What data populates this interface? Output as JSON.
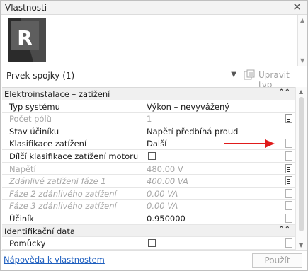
{
  "window": {
    "title": "Vlastnosti",
    "close_glyph": "✕"
  },
  "header": {
    "logo_letter": "R"
  },
  "type_selector": {
    "selected": "Prvek spojky (1)",
    "edit_type_label": "Upravit typ"
  },
  "properties": {
    "groups": [
      {
        "title": "Elektroinstalace – zatížení",
        "collapse_glyph": "⌃⌃",
        "rows": [
          {
            "label": "Typ systému",
            "value": "Výkon – nevyvážený",
            "state": "enabled",
            "control": "none"
          },
          {
            "label": "Počet pólů",
            "value": "1",
            "state": "disabled",
            "control": "edit"
          },
          {
            "label": "Stav účiníku",
            "value": "Napětí předbíhá proud",
            "state": "enabled",
            "control": "none"
          },
          {
            "label": "Klasifikace zatížení",
            "value": "Další",
            "state": "enabled",
            "control": "empty"
          },
          {
            "label": "Dílčí klasifikace zatížení motoru",
            "value": "",
            "state": "enabled",
            "control": "empty",
            "checkbox": true
          },
          {
            "label": "Napětí",
            "value": "480.00 V",
            "state": "disabled",
            "control": "edit"
          },
          {
            "label": "Zdánlivé zatížení fáze 1",
            "value": "400.00 VA",
            "state": "disabled-italic",
            "control": "edit"
          },
          {
            "label": "Fáze 2 zdánlivého zatížení",
            "value": "0.00 VA",
            "state": "disabled-italic",
            "control": "empty"
          },
          {
            "label": "Fáze 3 zdánlivého zatížení",
            "value": "0.00 VA",
            "state": "disabled-italic",
            "control": "empty"
          },
          {
            "label": "Účiník",
            "value": "0.950000",
            "state": "enabled",
            "control": "empty"
          }
        ]
      },
      {
        "title": "Identifikační data",
        "collapse_glyph": "⌃⌃",
        "rows": [
          {
            "label": "Pomůcky",
            "value": "",
            "state": "enabled",
            "control": "empty",
            "checkbox": true
          }
        ]
      }
    ]
  },
  "footer": {
    "help_link": "Nápověda k vlastnostem",
    "apply_label": "Použít"
  },
  "colors": {
    "annotation_arrow": "#e01b1b",
    "link": "#1f5fbf",
    "logo_bg": "#3a3a3a"
  },
  "icons": [
    "close-icon",
    "autodesk-revit-logo",
    "chevron-down-icon",
    "edit-type-icon",
    "collapse-icon",
    "edit-button-icon",
    "checkbox"
  ]
}
